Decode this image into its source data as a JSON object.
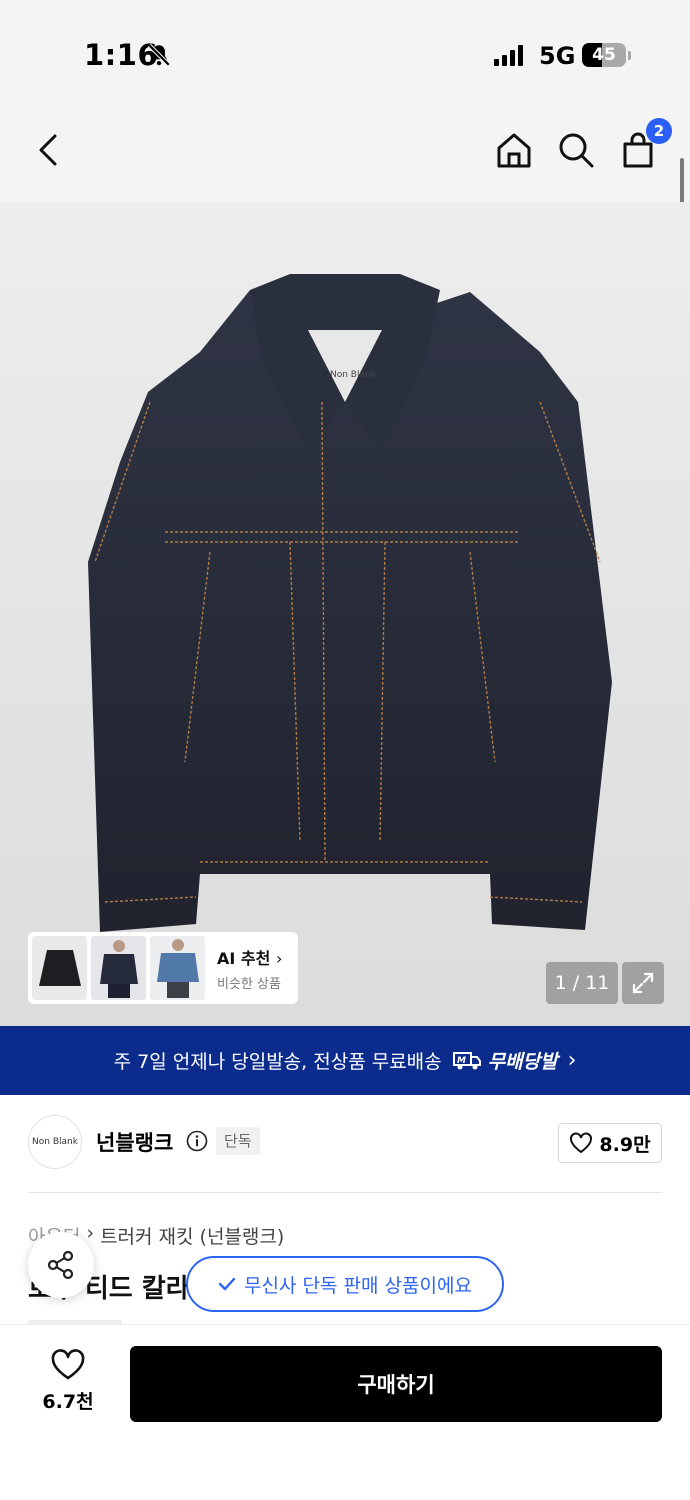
{
  "status_bar": {
    "time": "1:16",
    "network": "5G",
    "battery": "45",
    "battery_level": 0.45
  },
  "header": {
    "cart_count": "2"
  },
  "gallery": {
    "pager": "1 / 11",
    "ai_recommend": {
      "title": "AI 추천",
      "subtitle": "비슷한 상품"
    },
    "label_text": "Non Blank"
  },
  "banner": {
    "text": "주 7일 언제나 당일발송, 전상품 무료배송",
    "brand": "무배당발"
  },
  "brand": {
    "logo_text": "Non Blank",
    "name": "넌블랭크",
    "badge": "단독",
    "likes": "8.9만"
  },
  "breadcrumb": {
    "category": "아우터",
    "item": "트러커 재킷 (넌블랭크)"
  },
  "product": {
    "title_partial": "로우 티드 칼라"
  },
  "toast": {
    "text": "무신사 단독 판매 상품이에요"
  },
  "bottom_bar": {
    "wish_count": "6.7천",
    "buy_label": "구매하기"
  },
  "colors": {
    "banner": "#0b2c8c",
    "accent": "#2d64f0",
    "badge_blue": "#2b5ff5"
  }
}
